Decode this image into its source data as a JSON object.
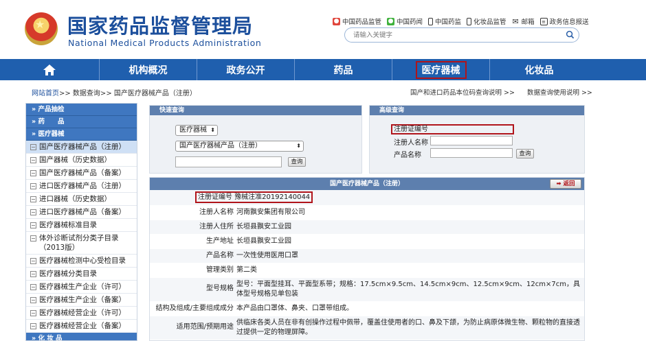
{
  "header": {
    "title": "国家药品监督管理局",
    "subtitle": "National Medical Products Administration",
    "top_links": [
      {
        "icon": "weibo-icon",
        "label": "中国药品监管"
      },
      {
        "icon": "wechat-icon",
        "label": "中国药闻"
      },
      {
        "icon": "mobile-icon",
        "label": "中国药监"
      },
      {
        "icon": "mobile-icon",
        "label": "化妆品监管"
      },
      {
        "icon": "mail-icon",
        "label": "邮箱"
      },
      {
        "icon": "info-icon",
        "label": "政务信息报送"
      }
    ],
    "search_placeholder": "请输入关键字"
  },
  "nav": {
    "items": [
      "机构概况",
      "政务公开",
      "药品",
      "医疗器械",
      "化妆品"
    ],
    "active": "医疗器械"
  },
  "breadcrumb": {
    "home": "网站首页",
    "trail": ">> 数据查询>> 国产医疗器械产品（注册）"
  },
  "help_links": [
    "国产和进口药品本位码查询说明 >>",
    "数据查询使用说明 >>"
  ],
  "sidebar": {
    "sections": [
      "» 产品抽检",
      "» 药　　品",
      "» 医疗器械",
      "» 化 妆 品"
    ],
    "items": [
      "国产医疗器械产品（注册）",
      "国产器械（历史数据）",
      "国产医疗器械产品（备案）",
      "进口医疗器械产品（注册）",
      "进口器械（历史数据）",
      "进口医疗器械产品（备案）",
      "医疗器械标准目录",
      "体外诊断试剂分类子目录（2013版）",
      "医疗器械检测中心受检目录",
      "医疗器械分类目录",
      "医疗器械生产企业（许可）",
      "医疗器械生产企业（备案）",
      "医疗器械经营企业（许可）",
      "医疗器械经营企业（备案）"
    ],
    "active_index": 0
  },
  "quick_query": {
    "title": "快速查询",
    "category": "医疗器械",
    "database": "国产医疗器械产品（注册）",
    "search_button": "查询"
  },
  "advanced_query": {
    "title": "高级查询",
    "field1": "注册证编号",
    "field2": "注册人名称",
    "field3": "产品名称",
    "search_button": "查询"
  },
  "detail": {
    "title": "国产医疗器械产品（注册）",
    "back_button": "返回",
    "rows": [
      {
        "label": "注册证编号",
        "value": "豫械注准20192140044"
      },
      {
        "label": "注册人名称",
        "value": "河南飘安集团有限公司"
      },
      {
        "label": "注册人住所",
        "value": "长垣县飘安工业园"
      },
      {
        "label": "生产地址",
        "value": "长垣县飘安工业园"
      },
      {
        "label": "产品名称",
        "value": "一次性使用医用口罩"
      },
      {
        "label": "管理类别",
        "value": "第二类"
      },
      {
        "label": "型号规格",
        "value": "型号：平面型挂耳、平面型系带；规格：17.5cm×9.5cm、14.5cm×9cm、12.5cm×9cm、12cm×7cm，具体型号规格见单包装"
      },
      {
        "label": "结构及组成/主要组成成分",
        "value": "本产品由口罩体、鼻夹、口罩带组成。"
      },
      {
        "label": "适用范围/预期用途",
        "value": "供临床各类人员在非有创操作过程中佩带，覆盖住使用者的口、鼻及下颌，为防止病原体微生物、颗粒物的直接透过提供一定的物理屏障。"
      }
    ]
  },
  "colors": {
    "brand_blue": "#1f5fae",
    "highlight_red": "#b0141a"
  }
}
